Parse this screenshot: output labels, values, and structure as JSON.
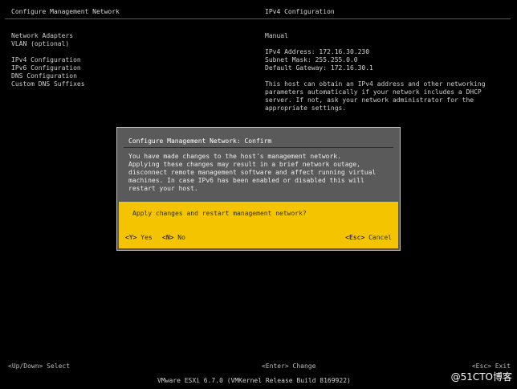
{
  "header": {
    "left_title": "Configure Management Network",
    "right_title": "IPv4 Configuration"
  },
  "menu": {
    "items": [
      {
        "label": "Network Adapters"
      },
      {
        "label": "VLAN (optional)"
      },
      {
        "label": "IPv4 Configuration"
      },
      {
        "label": "IPv6 Configuration"
      },
      {
        "label": "DNS Configuration"
      },
      {
        "label": "Custom DNS Suffixes"
      }
    ]
  },
  "detail": {
    "mode": "Manual",
    "ipv4_address": "IPv4 Address: 172.16.30.230",
    "subnet_mask": "Subnet Mask: 255.255.0.0",
    "default_gateway": "Default Gateway: 172.16.30.1",
    "description": "This host can obtain an IPv4 address and other networking parameters automatically if your network includes a DHCP server. If not, ask your network administrator for the appropriate settings."
  },
  "dialog": {
    "title": "Configure Management Network: Confirm",
    "message": "You have made changes to the host's management network.\nApplying these changes may result in a brief network outage,\ndisconnect remote management software and affect running virtual\nmachines. In case IPv6 has been enabled or disabled this will\nrestart your host.",
    "question": "Apply changes and restart management network?",
    "yes_key": "<Y>",
    "yes_label": "Yes",
    "no_key": "<N>",
    "no_label": "No",
    "cancel_key": "<Esc>",
    "cancel_label": "Cancel"
  },
  "footer": {
    "left": "<Up/Down> Select",
    "center": "<Enter> Change",
    "right": "<Esc> Exit"
  },
  "status": {
    "text": "VMware ESXi 6.7.0 (VMKernel Release Build 8169922)"
  },
  "watermark": "@51CTO博客",
  "colors": {
    "background": "#000000",
    "dialog_body": "#5a5a5a",
    "dialog_panel": "#f5c400"
  }
}
